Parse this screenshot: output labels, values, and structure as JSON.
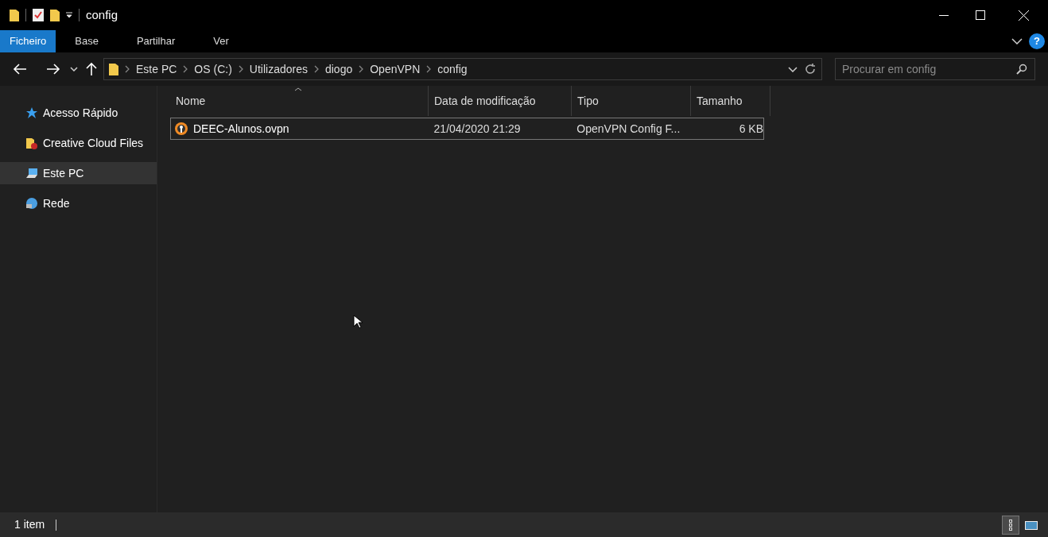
{
  "window": {
    "title": "config"
  },
  "help_button": {
    "label": "?"
  },
  "ribbon_tabs": [
    {
      "label": "Ficheiro",
      "selected": true
    },
    {
      "label": "Base",
      "selected": false
    },
    {
      "label": "Partilhar",
      "selected": false
    },
    {
      "label": "Ver",
      "selected": false
    }
  ],
  "breadcrumb": [
    "Este PC",
    "OS (C:)",
    "Utilizadores",
    "diogo",
    "OpenVPN",
    "config"
  ],
  "search": {
    "placeholder": "Procurar em config"
  },
  "sidebar": {
    "items": [
      {
        "kind": "star",
        "label": "Acesso Rápido",
        "selected": false
      },
      {
        "kind": "cloud",
        "label": "Creative Cloud Files",
        "selected": false
      },
      {
        "kind": "pc",
        "label": "Este PC",
        "selected": true
      },
      {
        "kind": "network",
        "label": "Rede",
        "selected": false
      }
    ]
  },
  "table": {
    "columns": [
      "Nome",
      "Data de modificação",
      "Tipo",
      "Tamanho"
    ],
    "rows": [
      {
        "name": "DEEC-Alunos.ovpn",
        "modified": "21/04/2020 21:29",
        "type": "OpenVPN Config F...",
        "size": "6 KB",
        "focused": true
      }
    ]
  },
  "status_bar": {
    "text": "1 item"
  },
  "view_buttons": [
    {
      "kind": "details",
      "selected": true
    },
    {
      "kind": "tiles",
      "selected": false
    }
  ]
}
